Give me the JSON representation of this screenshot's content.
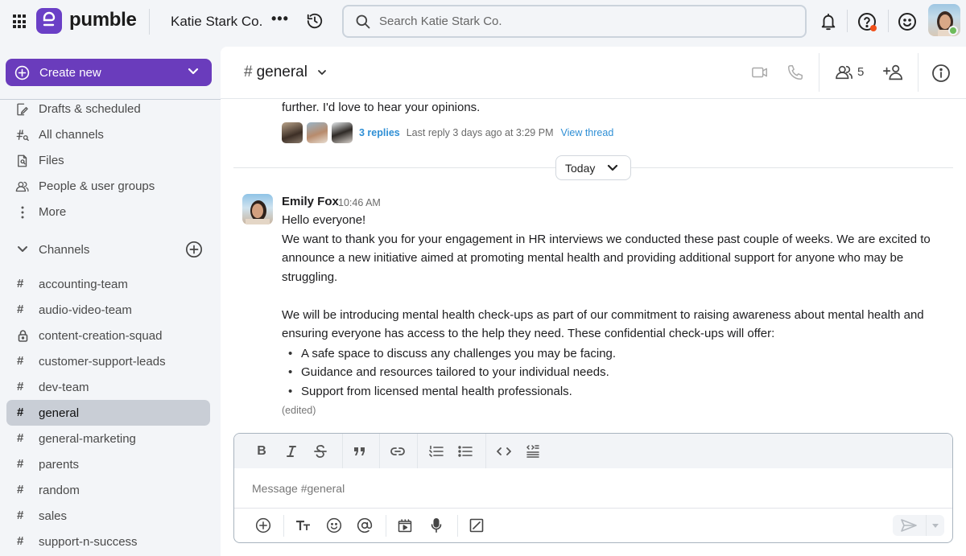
{
  "app": {
    "name": "pumble",
    "workspace": "Katie Stark Co.",
    "workspace_more": "•••",
    "search_placeholder": "Search Katie Stark Co.",
    "brand_color": "#6a3cbc"
  },
  "sidebar": {
    "create_new_label": "Create new",
    "nav": [
      {
        "label": "Drafts & scheduled",
        "icon": "drafts-icon"
      },
      {
        "label": "All channels",
        "icon": "channel-search-icon"
      },
      {
        "label": "Files",
        "icon": "file-search-icon"
      },
      {
        "label": "People & user groups",
        "icon": "people-icon"
      },
      {
        "label": "More",
        "icon": "more-vertical-icon"
      }
    ],
    "channels_header": "Channels",
    "channels": [
      {
        "name": "accounting-team",
        "private": false
      },
      {
        "name": "audio-video-team",
        "private": false
      },
      {
        "name": "content-creation-squad",
        "private": true
      },
      {
        "name": "customer-support-leads",
        "private": false
      },
      {
        "name": "dev-team",
        "private": false
      },
      {
        "name": "general",
        "private": false,
        "active": true
      },
      {
        "name": "general-marketing",
        "private": false
      },
      {
        "name": "parents",
        "private": false
      },
      {
        "name": "random",
        "private": false
      },
      {
        "name": "sales",
        "private": false
      },
      {
        "name": "support-n-success",
        "private": false
      }
    ]
  },
  "channel_header": {
    "hash": "#",
    "name": "general",
    "member_count": "5"
  },
  "thread_preview": {
    "text": "further. I'd love to hear your opinions.",
    "replies": "3 replies",
    "last_reply": "Last reply 3 days ago at 3:29 PM",
    "view_thread": "View thread"
  },
  "day_divider": "Today",
  "message": {
    "author": "Emily Fox",
    "time": "10:46 AM",
    "greeting": "Hello everyone!",
    "para1": "We want to thank you for your engagement in HR interviews we conducted these past couple of weeks. We are excited to announce a new initiative aimed at promoting mental health and providing additional support for anyone who may be struggling.",
    "para2": "We will be introducing mental health check-ups as part of our commitment to raising awareness about mental health and ensuring everyone has access to the help they need. These confidential check-ups will offer:",
    "bullets": [
      "A safe space to discuss any challenges you may be facing.",
      "Guidance and resources tailored to your individual needs.",
      "Support from licensed mental health professionals."
    ],
    "edited": "(edited)"
  },
  "composer": {
    "placeholder": "Message #general"
  }
}
